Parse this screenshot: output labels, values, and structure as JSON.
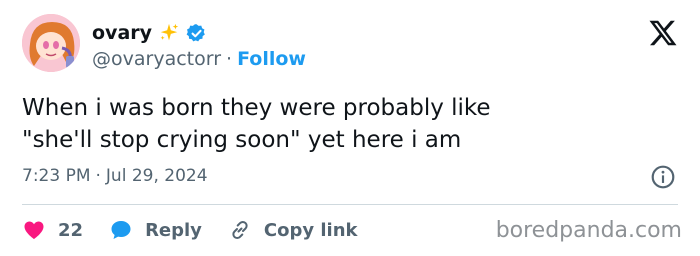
{
  "user": {
    "display_name": "ovary",
    "handle": "@ovaryactorr",
    "separator": "·",
    "follow_label": "Follow"
  },
  "tweet": {
    "lines": [
      "When i was born they were probably like",
      "\"she'll stop crying soon\" yet here i am"
    ],
    "time": "7:23 PM",
    "meta_separator": "·",
    "date": "Jul 29, 2024"
  },
  "actions": {
    "like_count": "22",
    "reply_label": "Reply",
    "copy_link_label": "Copy link"
  },
  "watermark": "boredpanda.com",
  "icons": {
    "avatar": "avatar-image",
    "sparkle": "sparkle-icon",
    "verified": "verified-badge-icon",
    "x_logo": "x-logo-icon",
    "info": "info-icon",
    "like": "heart-icon",
    "reply": "reply-bubble-icon",
    "link": "link-icon"
  },
  "colors": {
    "accent": "#1d9bf0",
    "like": "#f91880",
    "text": "#0f1419",
    "muted": "#536471",
    "sparkle": "#ffc107"
  }
}
